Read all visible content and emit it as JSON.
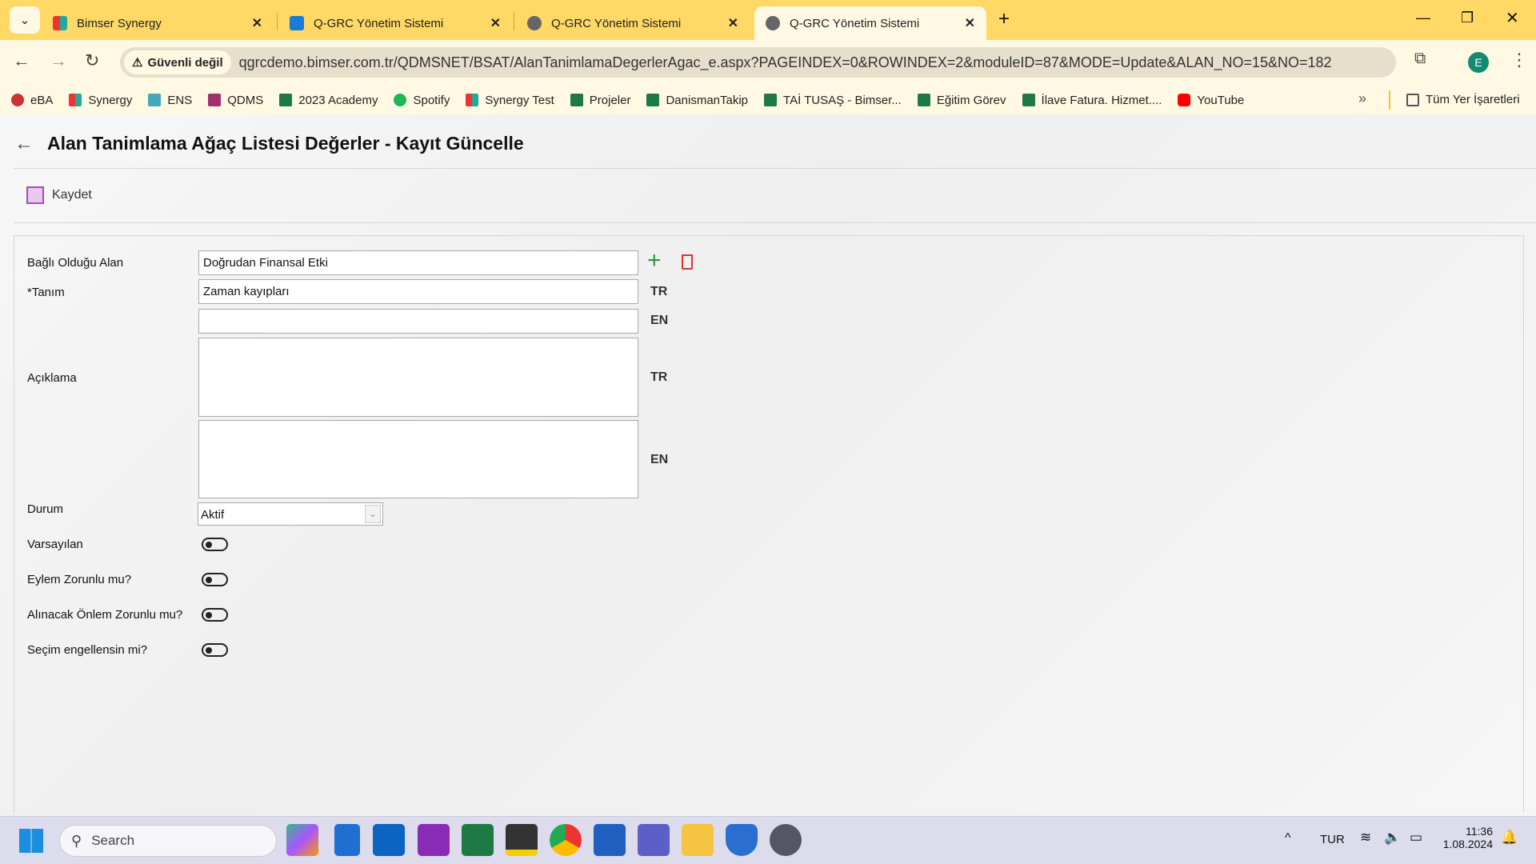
{
  "browser": {
    "tabs": [
      {
        "title": "Bimser Synergy",
        "active": false
      },
      {
        "title": "Q-GRC Yönetim Sistemi",
        "active": false
      },
      {
        "title": "Q-GRC Yönetim Sistemi",
        "active": false
      },
      {
        "title": "Q-GRC Yönetim Sistemi",
        "active": true
      }
    ],
    "security_label": "Güvenli değil",
    "url": "qgrcdemo.bimser.com.tr/QDMSNET/BSAT/AlanTanimlamaDegerlerAgac_e.aspx?PAGEINDEX=0&ROWINDEX=2&moduleID=87&MODE=Update&ALAN_NO=15&NO=182",
    "profile_initial": "E",
    "bookmarks": [
      "eBA",
      "Synergy",
      "ENS",
      "QDMS",
      "2023 Academy",
      "Spotify",
      "Synergy Test",
      "Projeler",
      "DanismanTakip",
      "TAİ TUSAŞ - Bimser...",
      "Eğitim Görev",
      "İlave Fatura. Hizmet....",
      "YouTube"
    ],
    "all_bookmarks": "Tüm Yer İşaretleri"
  },
  "page": {
    "title": "Alan Tanimlama Ağaç Listesi Değerler - Kayıt Güncelle",
    "save_label": "Kaydet",
    "form": {
      "parent_label": "Bağlı Olduğu Alan",
      "parent_value": "Doğrudan Finansal Etki",
      "name_label": "*Tanım",
      "name_tr": "Zaman kayıpları",
      "name_en": "",
      "desc_label": "Açıklama",
      "desc_tr": "",
      "desc_en": "",
      "lang_tr": "TR",
      "lang_en": "EN",
      "status_label": "Durum",
      "status_value": "Aktif",
      "toggles": [
        {
          "label": "Varsayılan",
          "on": false
        },
        {
          "label": "Eylem Zorunlu mu?",
          "on": false
        },
        {
          "label": "Alınacak Önlem Zorunlu mu?",
          "on": false
        },
        {
          "label": "Seçim engellensin mi?",
          "on": false
        }
      ]
    }
  },
  "taskbar": {
    "search_placeholder": "Search",
    "language": "TUR",
    "time": "11:36",
    "date": "1.08.2024"
  }
}
